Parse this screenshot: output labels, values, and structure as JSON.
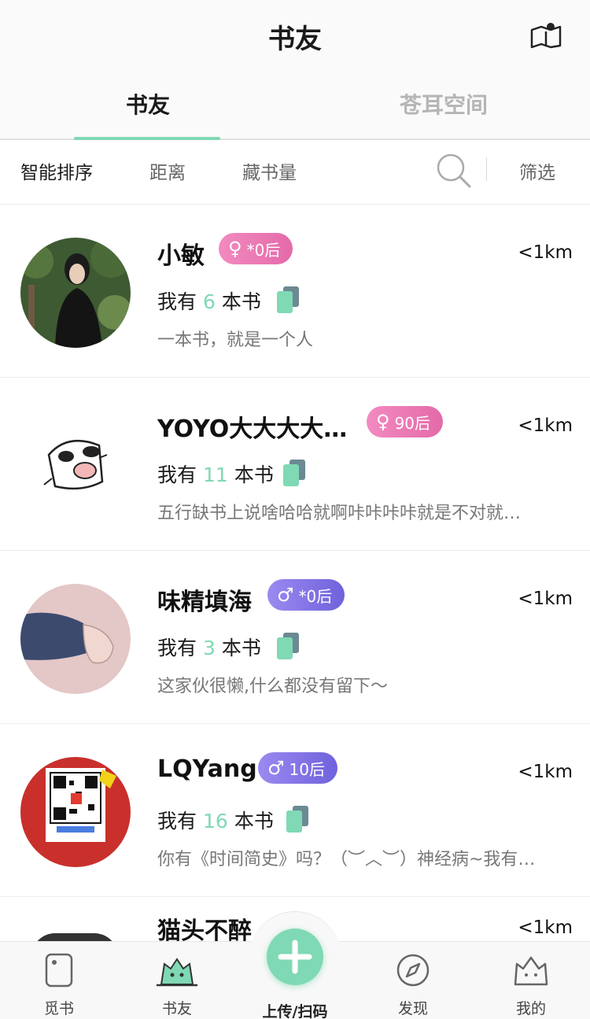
{
  "nav": {
    "title": "书友"
  },
  "segments": {
    "active": "书友",
    "inactive": "苍耳空间"
  },
  "filters": {
    "sort": "智能排序",
    "distance": "距离",
    "collection": "藏书量",
    "screen": "筛选"
  },
  "users": [
    {
      "name": "小敏",
      "gender": "female",
      "age": "*0后",
      "distance": "<1km",
      "books_prefix": "我有",
      "book_count": "6",
      "books_suffix": "本书",
      "bio": "一本书，就是一个人"
    },
    {
      "name": "YOYO大大大大…",
      "gender": "female",
      "age": "90后",
      "distance": "<1km",
      "books_prefix": "我有",
      "book_count": "11",
      "books_suffix": "本书",
      "bio": "五行缺书上说啥哈哈就啊咔咔咔咔就是不对就…"
    },
    {
      "name": "味精填海",
      "gender": "male",
      "age": "*0后",
      "distance": "<1km",
      "books_prefix": "我有",
      "book_count": "3",
      "books_suffix": "本书",
      "bio": "这家伙很懒,什么都没有留下～"
    },
    {
      "name": "LQYang",
      "gender": "male",
      "age": "10后",
      "distance": "<1km",
      "books_prefix": "我有",
      "book_count": "16",
      "books_suffix": "本书",
      "bio": "你有《时间简史》吗？（︶︿︶）神经病~我有…"
    },
    {
      "name": "猫头不醉",
      "distance": "<1km"
    }
  ],
  "tabbar": {
    "find_books": "觅书",
    "book_friends": "书友",
    "upload": "上传/扫码",
    "discover": "发现",
    "mine": "我的"
  },
  "colors": {
    "accent": "#7fd9b4",
    "female_badge": "#e46aa9",
    "male_badge": "#6f62dc"
  }
}
